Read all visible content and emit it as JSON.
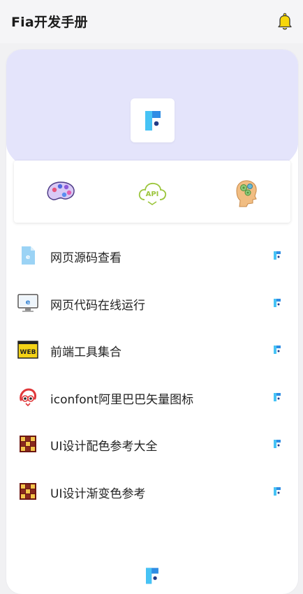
{
  "header": {
    "title": "Fia开发手册",
    "notification_icon": "bell-icon"
  },
  "colors": {
    "hero_background": "#e4e4fb",
    "brand_blue": "#2f8de4",
    "brand_cyan": "#46c3f5",
    "brand_navy": "#223a85",
    "bell_yellow": "#f7d70a"
  },
  "hero": {
    "logo_icon": "fia-logo-icon"
  },
  "quick_actions": [
    {
      "icon": "palette-icon"
    },
    {
      "icon": "api-cloud-icon"
    },
    {
      "icon": "head-gears-icon"
    }
  ],
  "menu": [
    {
      "label": "网页源码查看",
      "icon": "html-file-icon"
    },
    {
      "label": "网页代码在线运行",
      "icon": "monitor-browser-icon"
    },
    {
      "label": "前端工具集合",
      "icon": "web-badge-icon"
    },
    {
      "label": "iconfont阿里巴巴矢量图标",
      "icon": "iconfont-mascot-icon"
    },
    {
      "label": "UI设计配色参考大全",
      "icon": "color-grid-icon"
    },
    {
      "label": "UI设计渐变色参考",
      "icon": "color-grid-icon"
    }
  ]
}
